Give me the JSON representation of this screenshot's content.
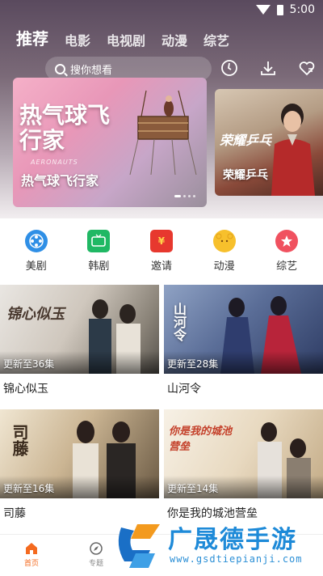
{
  "status_bar": {
    "time": "5:00"
  },
  "top_tabs": [
    {
      "label": "推荐",
      "active": true
    },
    {
      "label": "电影",
      "active": false
    },
    {
      "label": "电视剧",
      "active": false
    },
    {
      "label": "动漫",
      "active": false
    },
    {
      "label": "综艺",
      "active": false
    }
  ],
  "search": {
    "placeholder": "搜你想看"
  },
  "top_icons": [
    "history-icon",
    "download-icon",
    "favorite-icon"
  ],
  "banner": {
    "poster_title": "热气球飞行家",
    "poster_subtitle": "AERONAUTS",
    "caption": "热气球飞行家"
  },
  "banner2": {
    "poster_logo": "荣耀乒乓",
    "caption": "荣耀乒乓"
  },
  "categories": [
    {
      "label": "美剧",
      "icon": "film-reel-icon",
      "color": "#2f8fe6"
    },
    {
      "label": "韩剧",
      "icon": "tv-icon",
      "color": "#20b864"
    },
    {
      "label": "邀请",
      "icon": "red-envelope-icon",
      "color": "#e7382e"
    },
    {
      "label": "动漫",
      "icon": "bear-icon",
      "color": "#f7c02c"
    },
    {
      "label": "综艺",
      "icon": "star-icon",
      "color": "#f0515f"
    }
  ],
  "cards": [
    {
      "title": "锦心似玉",
      "update": "更新至36集",
      "poster_text": "锦心似玉"
    },
    {
      "title": "山河令",
      "update": "更新至28集",
      "poster_text": "山河令"
    },
    {
      "title": "司藤",
      "update": "更新至16集",
      "poster_text": "司藤"
    },
    {
      "title": "你是我的城池营垒",
      "update": "更新至14集",
      "poster_text": "你是我的城池营垒"
    }
  ],
  "bottom_nav": [
    {
      "label": "首页",
      "active": true
    },
    {
      "label": "专题",
      "active": false
    }
  ],
  "watermark": {
    "name": "广晟德手游",
    "url": "www.gsdtiepianji.com"
  },
  "colors": {
    "accent": "#f46a1f",
    "watermark": "#1e8ad8"
  }
}
